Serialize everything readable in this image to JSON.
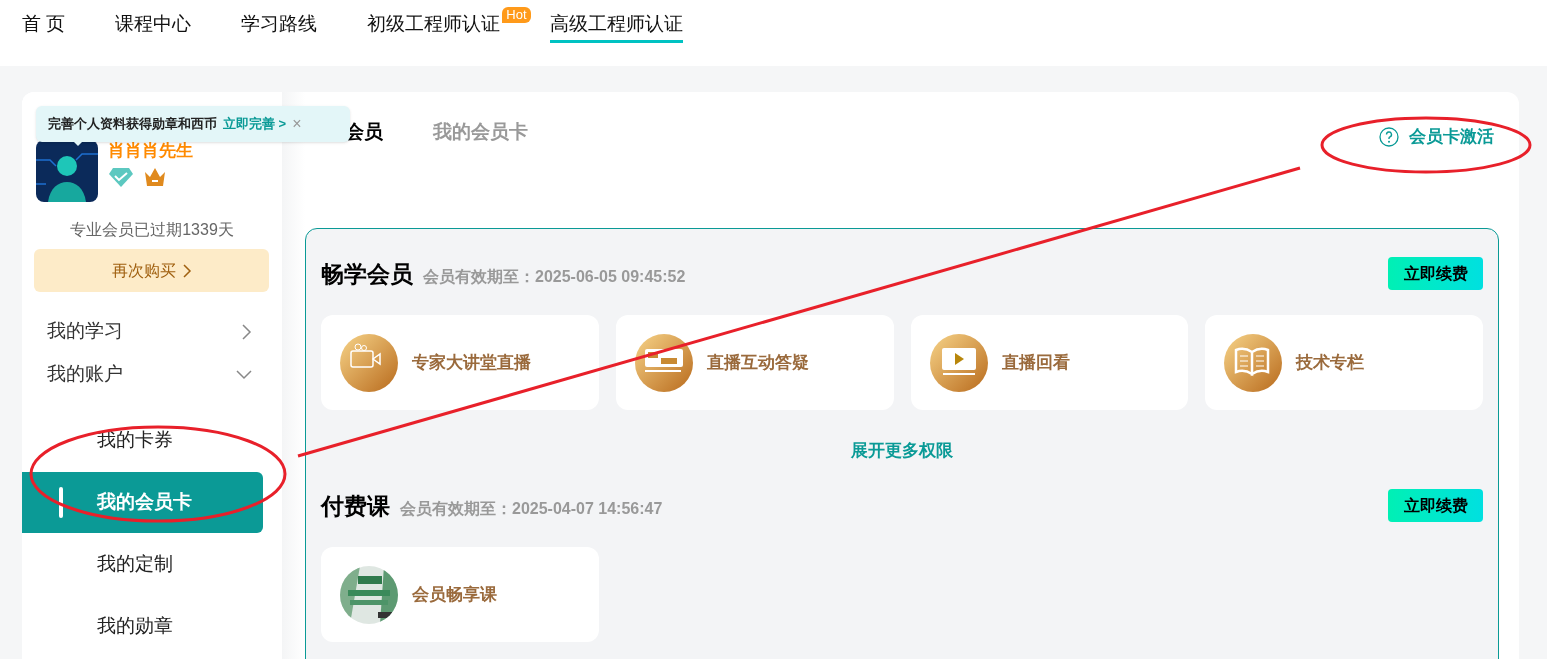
{
  "nav": [
    {
      "label": "首 页",
      "selected": false
    },
    {
      "label": "课程中心",
      "selected": false
    },
    {
      "label": "学习路线",
      "selected": false
    },
    {
      "label": "初级工程师认证",
      "badge": "Hot",
      "selected": false
    },
    {
      "label": "高级工程师认证",
      "selected": true
    }
  ],
  "tooltip": {
    "text": "完善个人资料获得勋章和西币",
    "link": "立即完善 >",
    "close": "×"
  },
  "profile": {
    "name": "肖肖肖先生",
    "expiry": "专业会员已过期1339天",
    "buy_button": "再次购买"
  },
  "sidebar": [
    {
      "label": "我的学习",
      "expanded": false
    },
    {
      "label": "我的账户",
      "expanded": true,
      "children": [
        {
          "label": "我的卡券",
          "selected": false
        },
        {
          "label": "我的会员卡",
          "selected": true
        },
        {
          "label": "我的定制",
          "selected": false
        },
        {
          "label": "我的勋章",
          "selected": false
        }
      ]
    }
  ],
  "tabs": [
    {
      "label": "会员",
      "selected": true
    },
    {
      "label": "我的会员卡",
      "selected": false
    }
  ],
  "activate_link": "会员卡激活",
  "sections": [
    {
      "title": "畅学会员",
      "expiry": "会员有效期至：2025-06-05 09:45:52",
      "renew": "立即续费",
      "more": "展开更多权限",
      "items": [
        {
          "kind": "camera",
          "label": "专家大讲堂直播"
        },
        {
          "kind": "chat",
          "label": "直播互动答疑"
        },
        {
          "kind": "play",
          "label": "直播回看"
        },
        {
          "kind": "book",
          "label": "技术专栏"
        }
      ]
    },
    {
      "title": "付费课",
      "expiry": "会员有效期至：2025-04-07 14:56:47",
      "renew": "立即续费",
      "items": [
        {
          "kind": "picture",
          "label": "会员畅享课"
        }
      ]
    }
  ]
}
